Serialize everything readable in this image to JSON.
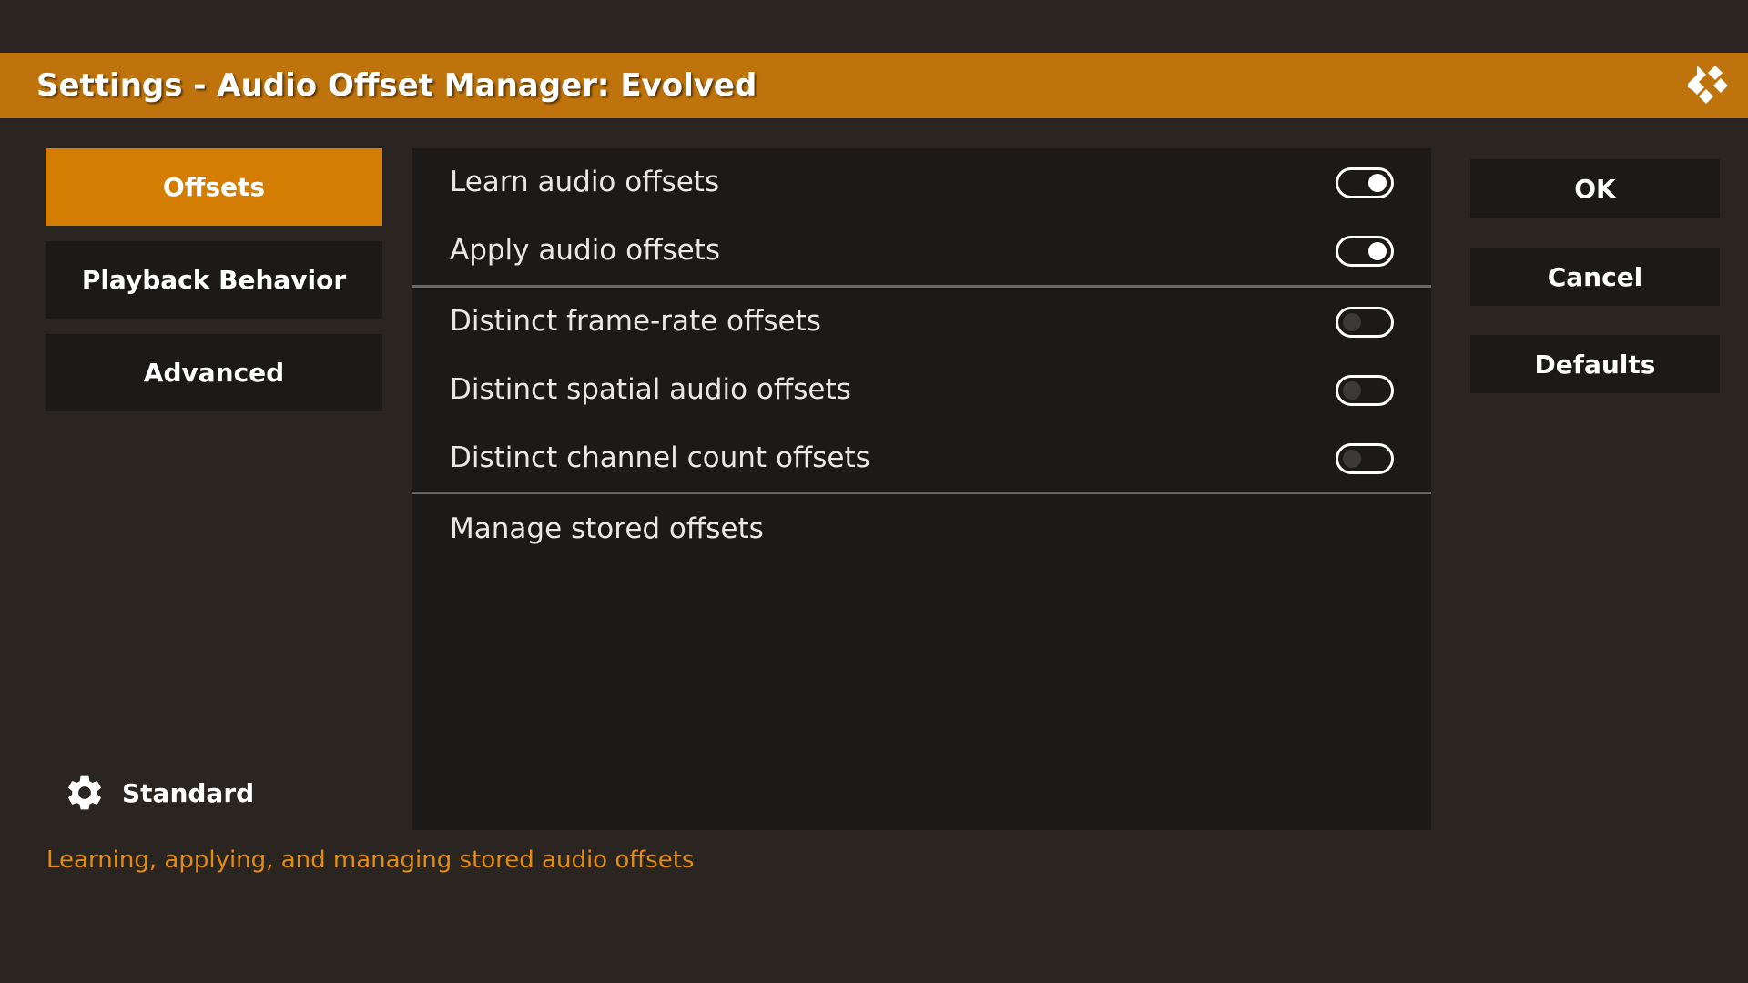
{
  "window": {
    "title": "Settings - Audio Offset Manager: Evolved",
    "accent_color": "#bf730c"
  },
  "categories": [
    {
      "label": "Offsets",
      "active": true
    },
    {
      "label": "Playback Behavior",
      "active": false
    },
    {
      "label": "Advanced",
      "active": false
    }
  ],
  "settings": [
    {
      "label": "Learn audio offsets",
      "enabled": true
    },
    {
      "label": "Apply audio offsets",
      "enabled": true
    },
    {
      "label": "Distinct frame-rate offsets",
      "enabled": false
    },
    {
      "label": "Distinct spatial audio offsets",
      "enabled": false
    },
    {
      "label": "Distinct channel count offsets",
      "enabled": false
    },
    {
      "label": "Manage stored offsets"
    }
  ],
  "buttons": {
    "ok": "OK",
    "cancel": "Cancel",
    "defaults": "Defaults"
  },
  "settings_level": {
    "label": "Standard",
    "icon": "gear-icon"
  },
  "description": "Learning, applying, and managing stored audio offsets"
}
